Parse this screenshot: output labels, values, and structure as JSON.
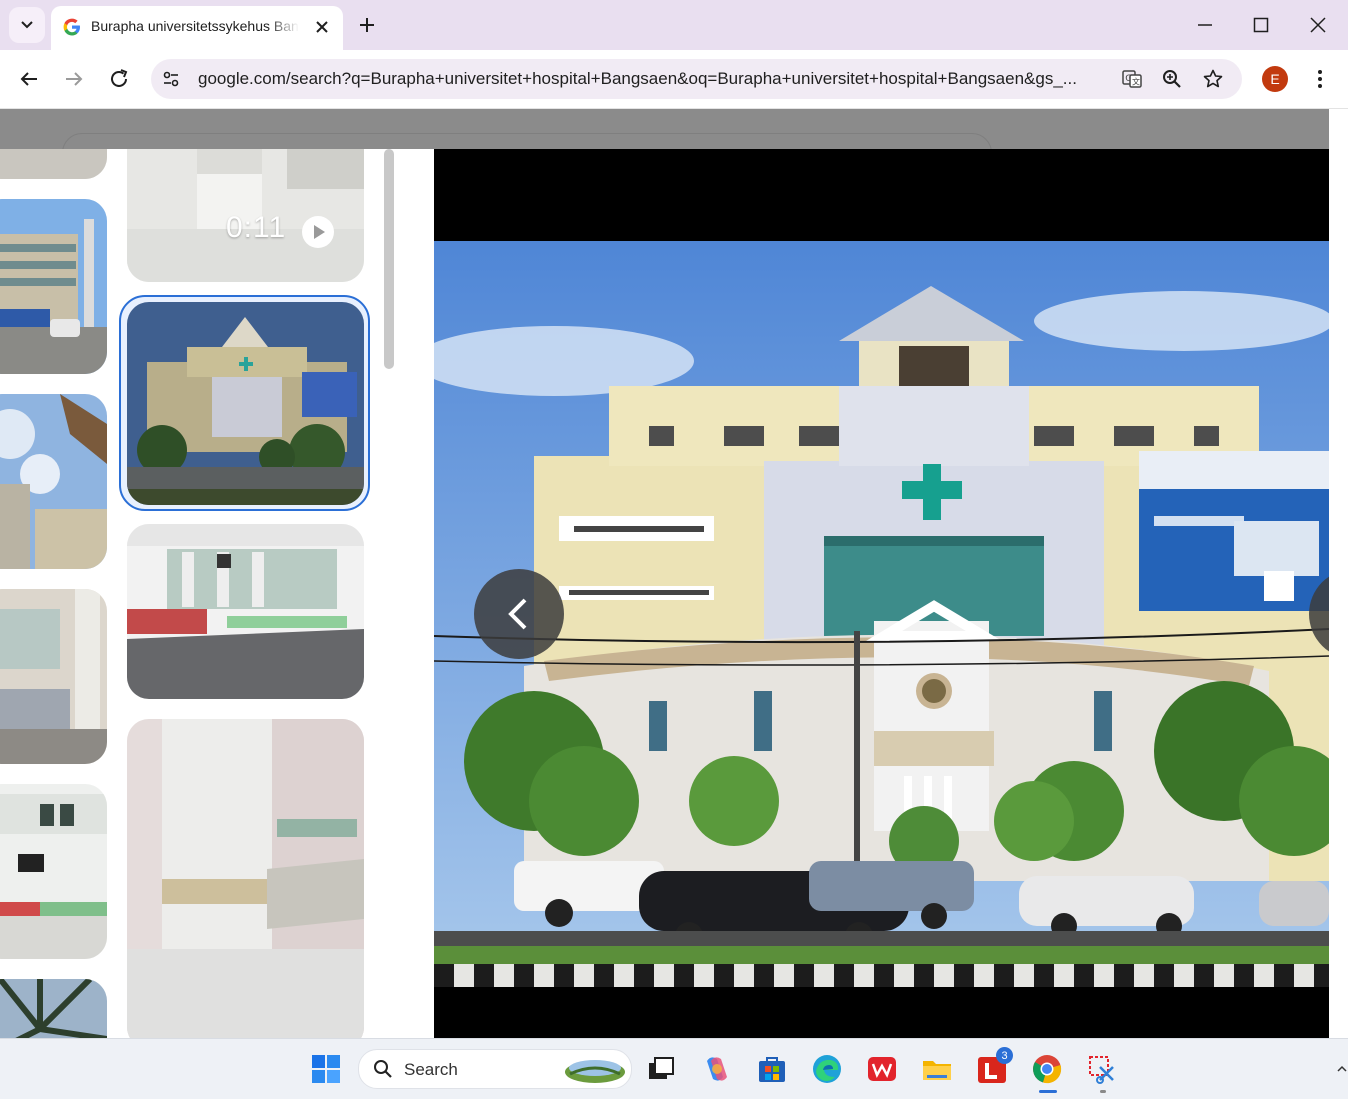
{
  "browser": {
    "tab_title": "Burapha universitetssykehus Bangsaen",
    "url": "google.com/search?q=Burapha+universitet+hospital+Bangsaen&oq=Burapha+universitet+hospital+Bangsaen&gs_...",
    "profile_initial": "E"
  },
  "image_viewer": {
    "video_duration": "0:11"
  },
  "taskbar": {
    "search_label": "Search",
    "notification_count": "3"
  },
  "colors": {
    "tabstrip": "#e9dff0",
    "omnibox": "#f1ebf4",
    "profile": "#c23a0e",
    "selection": "#2b6fd6"
  }
}
